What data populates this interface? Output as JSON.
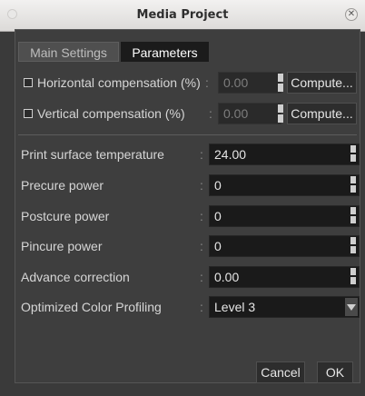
{
  "window": {
    "title": "Media Project"
  },
  "tabs": [
    {
      "label": "Main Settings",
      "active": false
    },
    {
      "label": "Parameters",
      "active": true
    }
  ],
  "compensation": [
    {
      "label": "Horizontal compensation (%)",
      "colon": ":",
      "value": "0.00",
      "button": "Compute...",
      "checked": false
    },
    {
      "label": "Vertical compensation (%)",
      "colon": ":",
      "value": "0.00",
      "button": "Compute...",
      "checked": false
    }
  ],
  "fields": [
    {
      "label": "Print surface temperature",
      "colon": ":",
      "value": "24.00"
    },
    {
      "label": "Precure power",
      "colon": ":",
      "value": "0"
    },
    {
      "label": "Postcure power",
      "colon": ":",
      "value": "0"
    },
    {
      "label": "Pincure power",
      "colon": ":",
      "value": "0"
    },
    {
      "label": "Advance correction",
      "colon": ":",
      "value": "0.00"
    }
  ],
  "profiling": {
    "label": "Optimized Color Profiling",
    "colon": ":",
    "value": "Level 3"
  },
  "buttons": {
    "cancel": "Cancel",
    "ok": "OK"
  },
  "colors": {
    "background": "#3a3a3a",
    "field": "#1a1a1a",
    "active_tab": "#1b1b1b"
  }
}
